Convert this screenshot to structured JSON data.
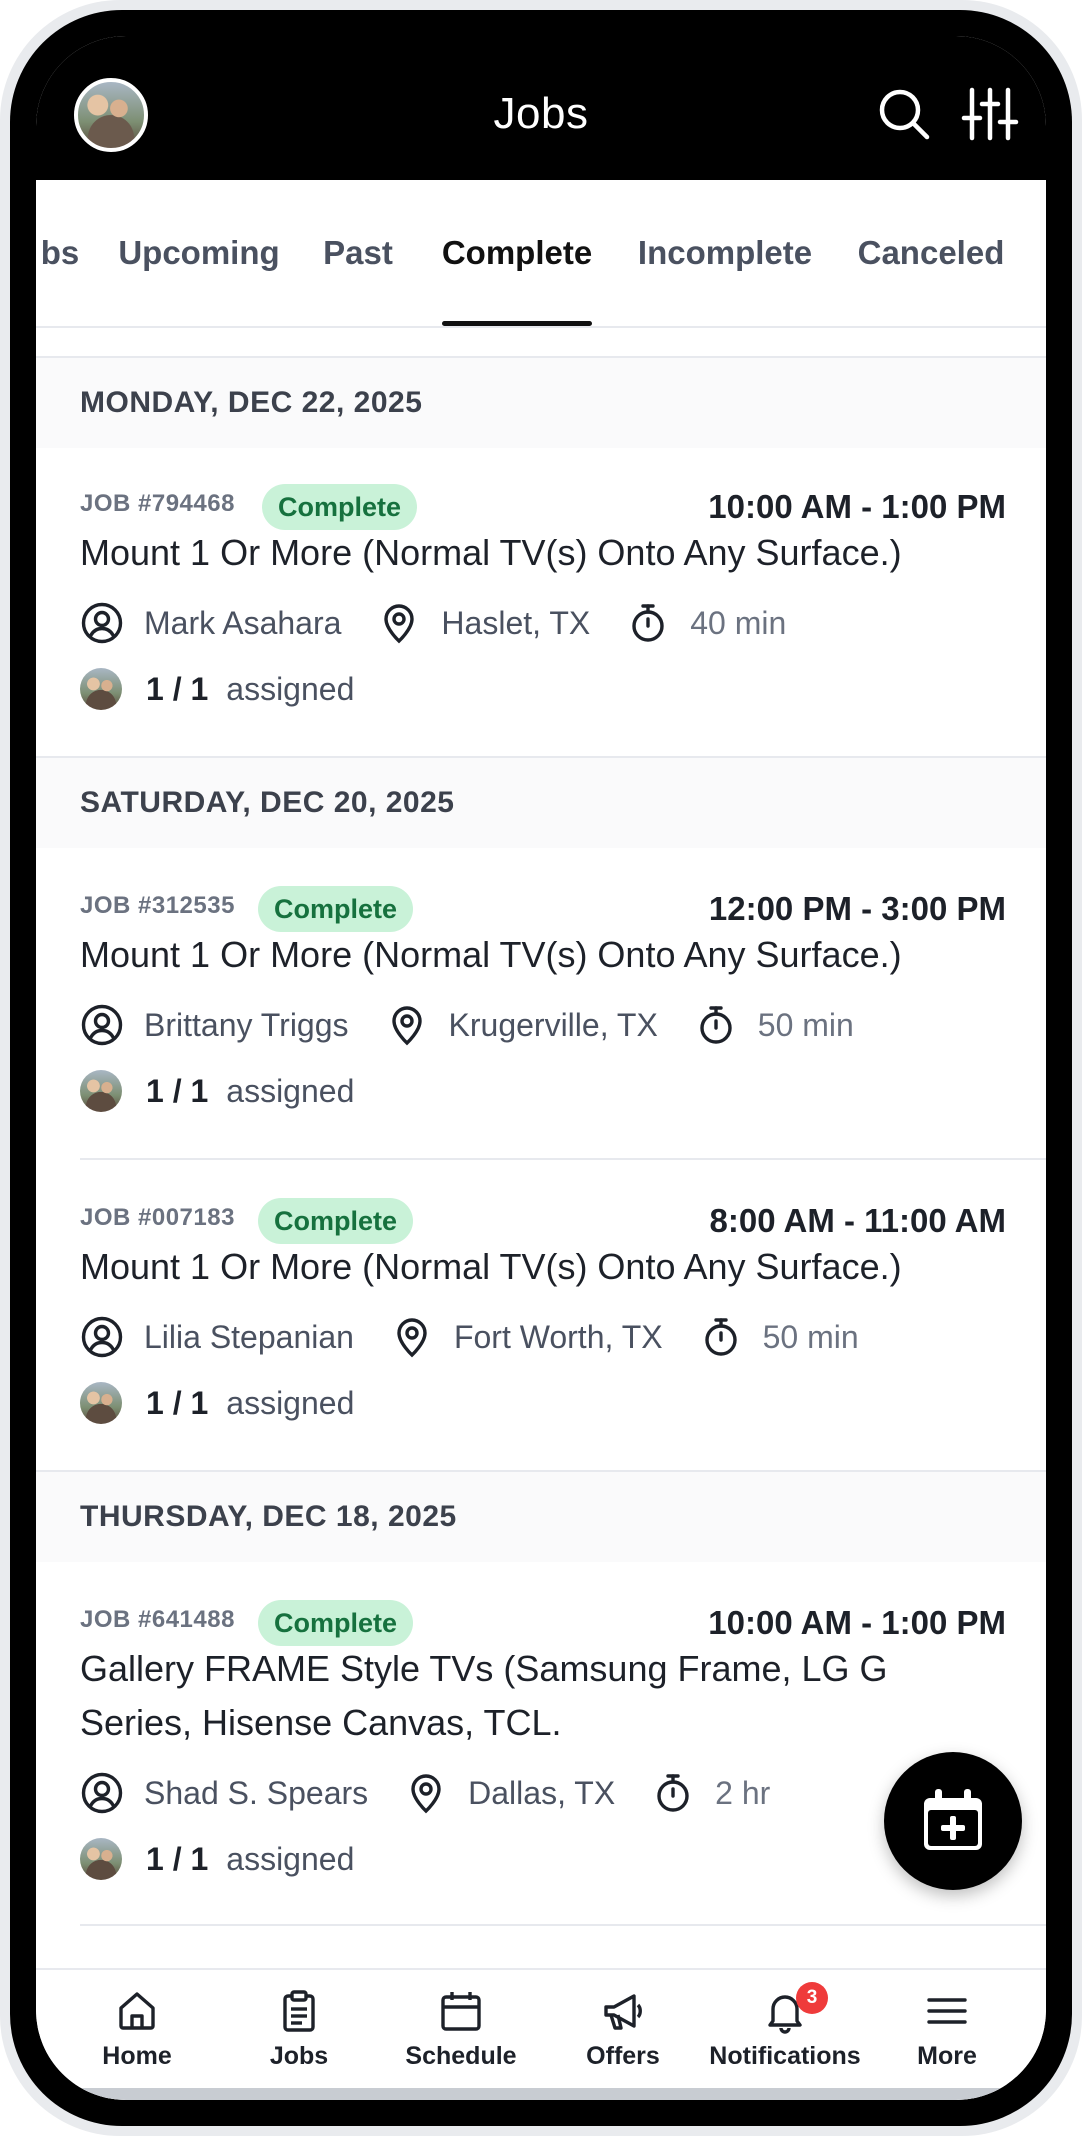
{
  "header": {
    "title": "Jobs",
    "search_icon": "search-icon",
    "filter_icon": "sliders-icon"
  },
  "tabs": [
    {
      "label": "bs"
    },
    {
      "label": "Upcoming"
    },
    {
      "label": "Past"
    },
    {
      "label": "Complete",
      "active": true
    },
    {
      "label": "Incomplete"
    },
    {
      "label": "Canceled"
    }
  ],
  "groups": [
    {
      "date": "MONDAY, DEC 22, 2025",
      "jobs": [
        {
          "job_number": "JOB #794468",
          "status": "Complete",
          "time": "10:00 AM - 1:00 PM",
          "title": "Mount 1 Or More (Normal TV(s) Onto Any Surface.)",
          "customer": "Mark Asahara",
          "location": "Haslet, TX",
          "duration": "40 min",
          "assigned_count": "1 / 1",
          "assigned_label": "assigned"
        }
      ]
    },
    {
      "date": "SATURDAY, DEC 20, 2025",
      "jobs": [
        {
          "job_number": "JOB #312535",
          "status": "Complete",
          "time": "12:00 PM - 3:00 PM",
          "title": "Mount 1 Or More (Normal TV(s) Onto Any Surface.)",
          "customer": "Brittany Triggs",
          "location": "Krugerville, TX",
          "duration": "50 min",
          "assigned_count": "1 / 1",
          "assigned_label": "assigned"
        },
        {
          "job_number": "JOB #007183",
          "status": "Complete",
          "time": "8:00 AM - 11:00 AM",
          "title": "Mount 1 Or More (Normal TV(s) Onto Any Surface.)",
          "customer": "Lilia Stepanian",
          "location": "Fort Worth, TX",
          "duration": "50 min",
          "assigned_count": "1 / 1",
          "assigned_label": "assigned"
        }
      ]
    },
    {
      "date": "THURSDAY, DEC 18, 2025",
      "jobs": [
        {
          "job_number": "JOB #641488",
          "status": "Complete",
          "time": "10:00 AM - 1:00 PM",
          "title_line1": "Gallery FRAME Style TVs (Samsung Frame, LG G",
          "title_line2": "Series, Hisense Canvas, TCL.",
          "customer": "Shad S. Spears",
          "location": "Dallas, TX",
          "duration": "2 hr",
          "assigned_count": "1 / 1",
          "assigned_label": "assigned"
        }
      ]
    }
  ],
  "fab": {
    "icon": "calendar-plus-icon"
  },
  "bottom_nav": [
    {
      "label": "Home",
      "icon": "home-icon"
    },
    {
      "label": "Jobs",
      "icon": "clipboard-icon",
      "active": true
    },
    {
      "label": "Schedule",
      "icon": "calendar-icon"
    },
    {
      "label": "Offers",
      "icon": "megaphone-icon"
    },
    {
      "label": "Notifications",
      "icon": "bell-icon",
      "badge": "3"
    },
    {
      "label": "More",
      "icon": "menu-icon"
    }
  ],
  "colors": {
    "header_bg": "#000000",
    "badge_bg": "#c9f2d8",
    "badge_text": "#16713e",
    "notification_badge": "#ef3b3b"
  }
}
